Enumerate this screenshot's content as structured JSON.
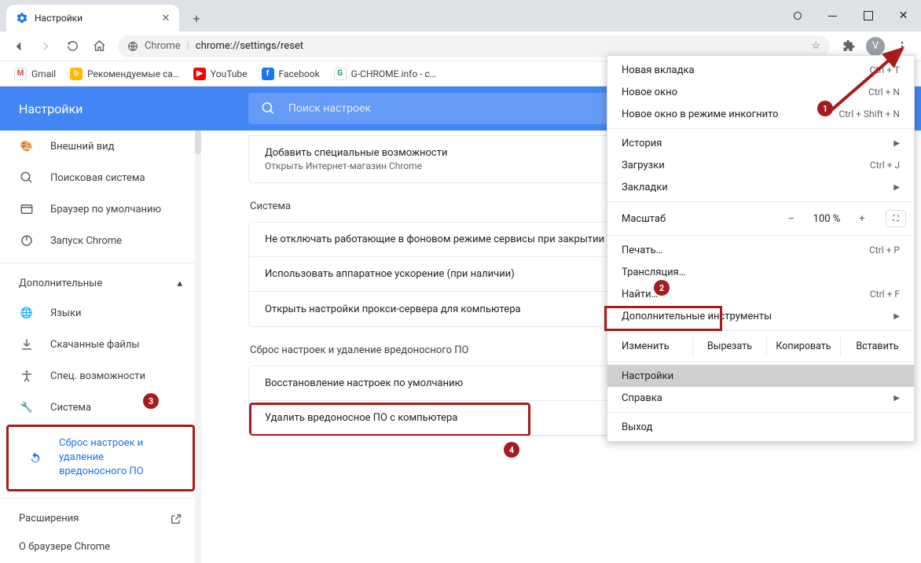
{
  "titlebar": {
    "tab_title": "Настройки"
  },
  "omnibox": {
    "scheme_label": "Chrome",
    "url": "chrome://settings/reset"
  },
  "toolbar": {
    "avatar_letter": "V"
  },
  "bookmarks": [
    {
      "label": "Gmail",
      "color": "#ea4335",
      "glyph": "M"
    },
    {
      "label": "Рекомендуемые са…",
      "color": "#ffb900",
      "glyph": "b"
    },
    {
      "label": "YouTube",
      "color": "#ff0000",
      "glyph": "▶"
    },
    {
      "label": "Facebook",
      "color": "#1877f2",
      "glyph": "f"
    },
    {
      "label": "G-CHROME.info - с…",
      "color": "#0f9d58",
      "glyph": "G"
    }
  ],
  "settings_header": {
    "title": "Настройки",
    "search_placeholder": "Поиск настроек"
  },
  "sidebar": {
    "items_top": [
      {
        "key": "appearance",
        "label": "Внешний вид",
        "icon": "palette"
      },
      {
        "key": "search",
        "label": "Поисковая система",
        "icon": "search"
      },
      {
        "key": "default",
        "label": "Браузер по умолчанию",
        "icon": "browser"
      },
      {
        "key": "startup",
        "label": "Запуск Chrome",
        "icon": "power"
      }
    ],
    "advanced_label": "Дополнительные",
    "items_adv": [
      {
        "key": "languages",
        "label": "Языки",
        "icon": "globe"
      },
      {
        "key": "downloads",
        "label": "Скачанные файлы",
        "icon": "download"
      },
      {
        "key": "a11y",
        "label": "Спец. возможности",
        "icon": "a11y"
      },
      {
        "key": "system",
        "label": "Система",
        "icon": "wrench"
      },
      {
        "key": "reset",
        "label": "Сброс настроек и удаление вредоносного ПО",
        "icon": "restore",
        "active": true
      }
    ],
    "extensions_label": "Расширения",
    "about_label": "О браузере Chrome"
  },
  "content": {
    "card0_cut": {
      "title": "Добавить специальные возможности",
      "sub": "Открыть Интернет-магазин Chrome"
    },
    "system_title": "Система",
    "system_rows": [
      "Не отключать работающие в фоновом режиме сервисы при закрытии браузера",
      "Использовать аппаратное ускорение (при наличии)",
      "Открыть настройки прокси-сервера для компьютера"
    ],
    "reset_title": "Сброс настроек и удаление вредоносного ПО",
    "reset_rows": [
      "Восстановление настроек по умолчанию",
      "Удалить вредоносное ПО с компьютера"
    ]
  },
  "menu": {
    "new_tab": {
      "label": "Новая вкладка",
      "shortcut": "Ctrl + T"
    },
    "new_window": {
      "label": "Новое окно",
      "shortcut": "Ctrl + N"
    },
    "incognito": {
      "label": "Новое окно в режиме инкогнито",
      "shortcut": "Ctrl + Shift + N"
    },
    "history": {
      "label": "История"
    },
    "downloads": {
      "label": "Загрузки",
      "shortcut": "Ctrl + J"
    },
    "bookmarks": {
      "label": "Закладки"
    },
    "zoom": {
      "label": "Масштаб",
      "value": "100 %"
    },
    "print": {
      "label": "Печать…",
      "shortcut": "Ctrl + P"
    },
    "cast": {
      "label": "Трансляция…"
    },
    "find": {
      "label": "Найти…",
      "shortcut": "Ctrl + F"
    },
    "more_tools": {
      "label": "Дополнительные инструменты"
    },
    "edit": {
      "label": "Изменить",
      "cut": "Вырезать",
      "copy": "Копировать",
      "paste": "Вставить"
    },
    "settings": {
      "label": "Настройки"
    },
    "help": {
      "label": "Справка"
    },
    "exit": {
      "label": "Выход"
    }
  }
}
